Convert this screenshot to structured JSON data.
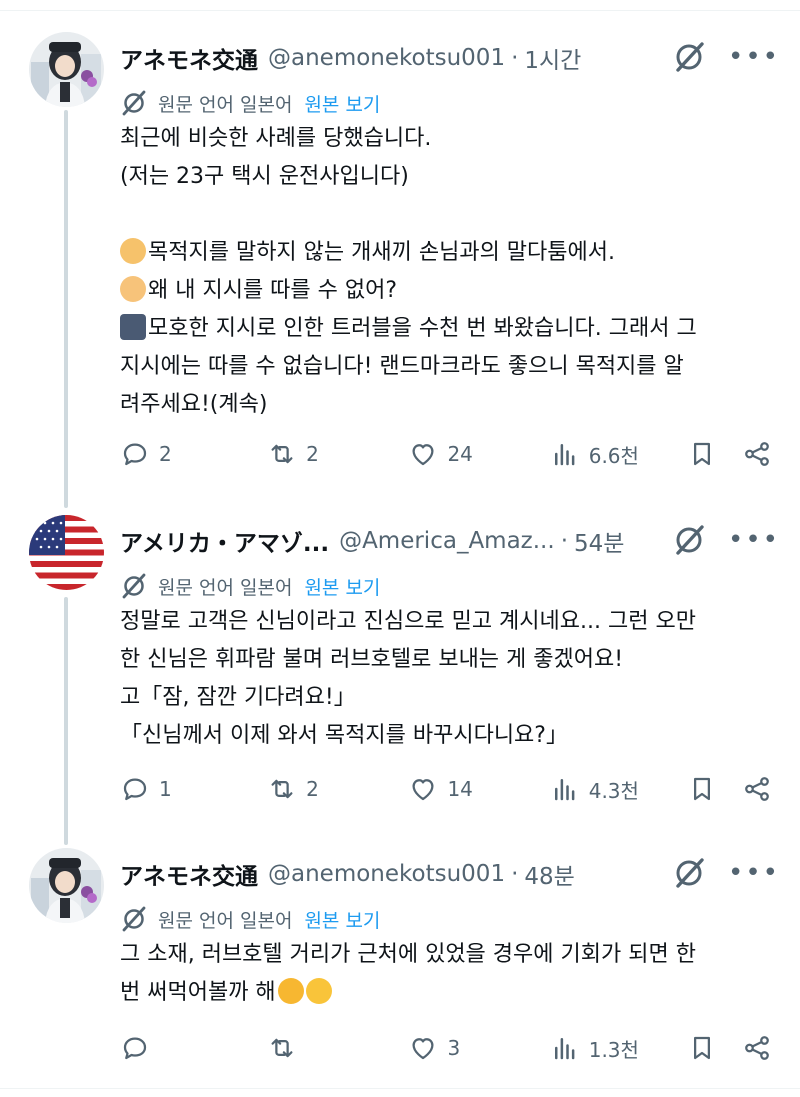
{
  "tweets": [
    {
      "name": "アネモネ交通",
      "handle": "@anemonekotsu001",
      "separator": "·",
      "time": "1시간",
      "translate_text": "원문 언어 일본어",
      "translate_link": "원본 보기",
      "lines": [
        "최근에 비슷한 사례를 당했습니다.",
        "(저는 23구 택시 운전사입니다)",
        "",
        "목적지를 말하지 않는 개새끼 손님과의 말다툼에서.",
        "왜 내 지시를 따를 수 없어?",
        "모호한 지시로 인한 트러블을 수천 번 봐왔습니다. 그래서 그",
        "지시에는 따를 수 없습니다! 랜드마크라도 좋으니 목적지를 알",
        "려주세요!(계속)"
      ],
      "replies": "2",
      "reposts": "2",
      "likes": "24",
      "views": "6.6천"
    },
    {
      "name": "アメリカ・アマゾ...",
      "handle": "@America_Amaz...",
      "separator": "·",
      "time": "54분",
      "translate_text": "원문 언어 일본어",
      "translate_link": "원본 보기",
      "lines": [
        "정말로 고객은 신님이라고 진심으로 믿고 계시네요... 그런 오만",
        "한 신님은 휘파람 불며 러브호텔로 보내는 게 좋겠어요!",
        "고「잠, 잠깐 기다려요!」",
        "「신님께서 이제 와서 목적지를 바꾸시다니요?」"
      ],
      "replies": "1",
      "reposts": "2",
      "likes": "14",
      "views": "4.3천"
    },
    {
      "name": "アネモネ交通",
      "handle": "@anemonekotsu001",
      "separator": "·",
      "time": "48분",
      "translate_text": "원문 언어 일본어",
      "translate_link": "원본 보기",
      "lines": [
        "그 소재, 러브호텔 거리가 근처에 있었을 경우에 기회가 되면 한",
        "번 써먹어볼까 해"
      ],
      "replies": "",
      "reposts": "",
      "likes": "3",
      "views": "1.3천"
    }
  ],
  "colors": {
    "text": "#0f1419",
    "secondary": "#536471",
    "link": "#1d9bf0",
    "thread_line": "#cfd9de"
  }
}
